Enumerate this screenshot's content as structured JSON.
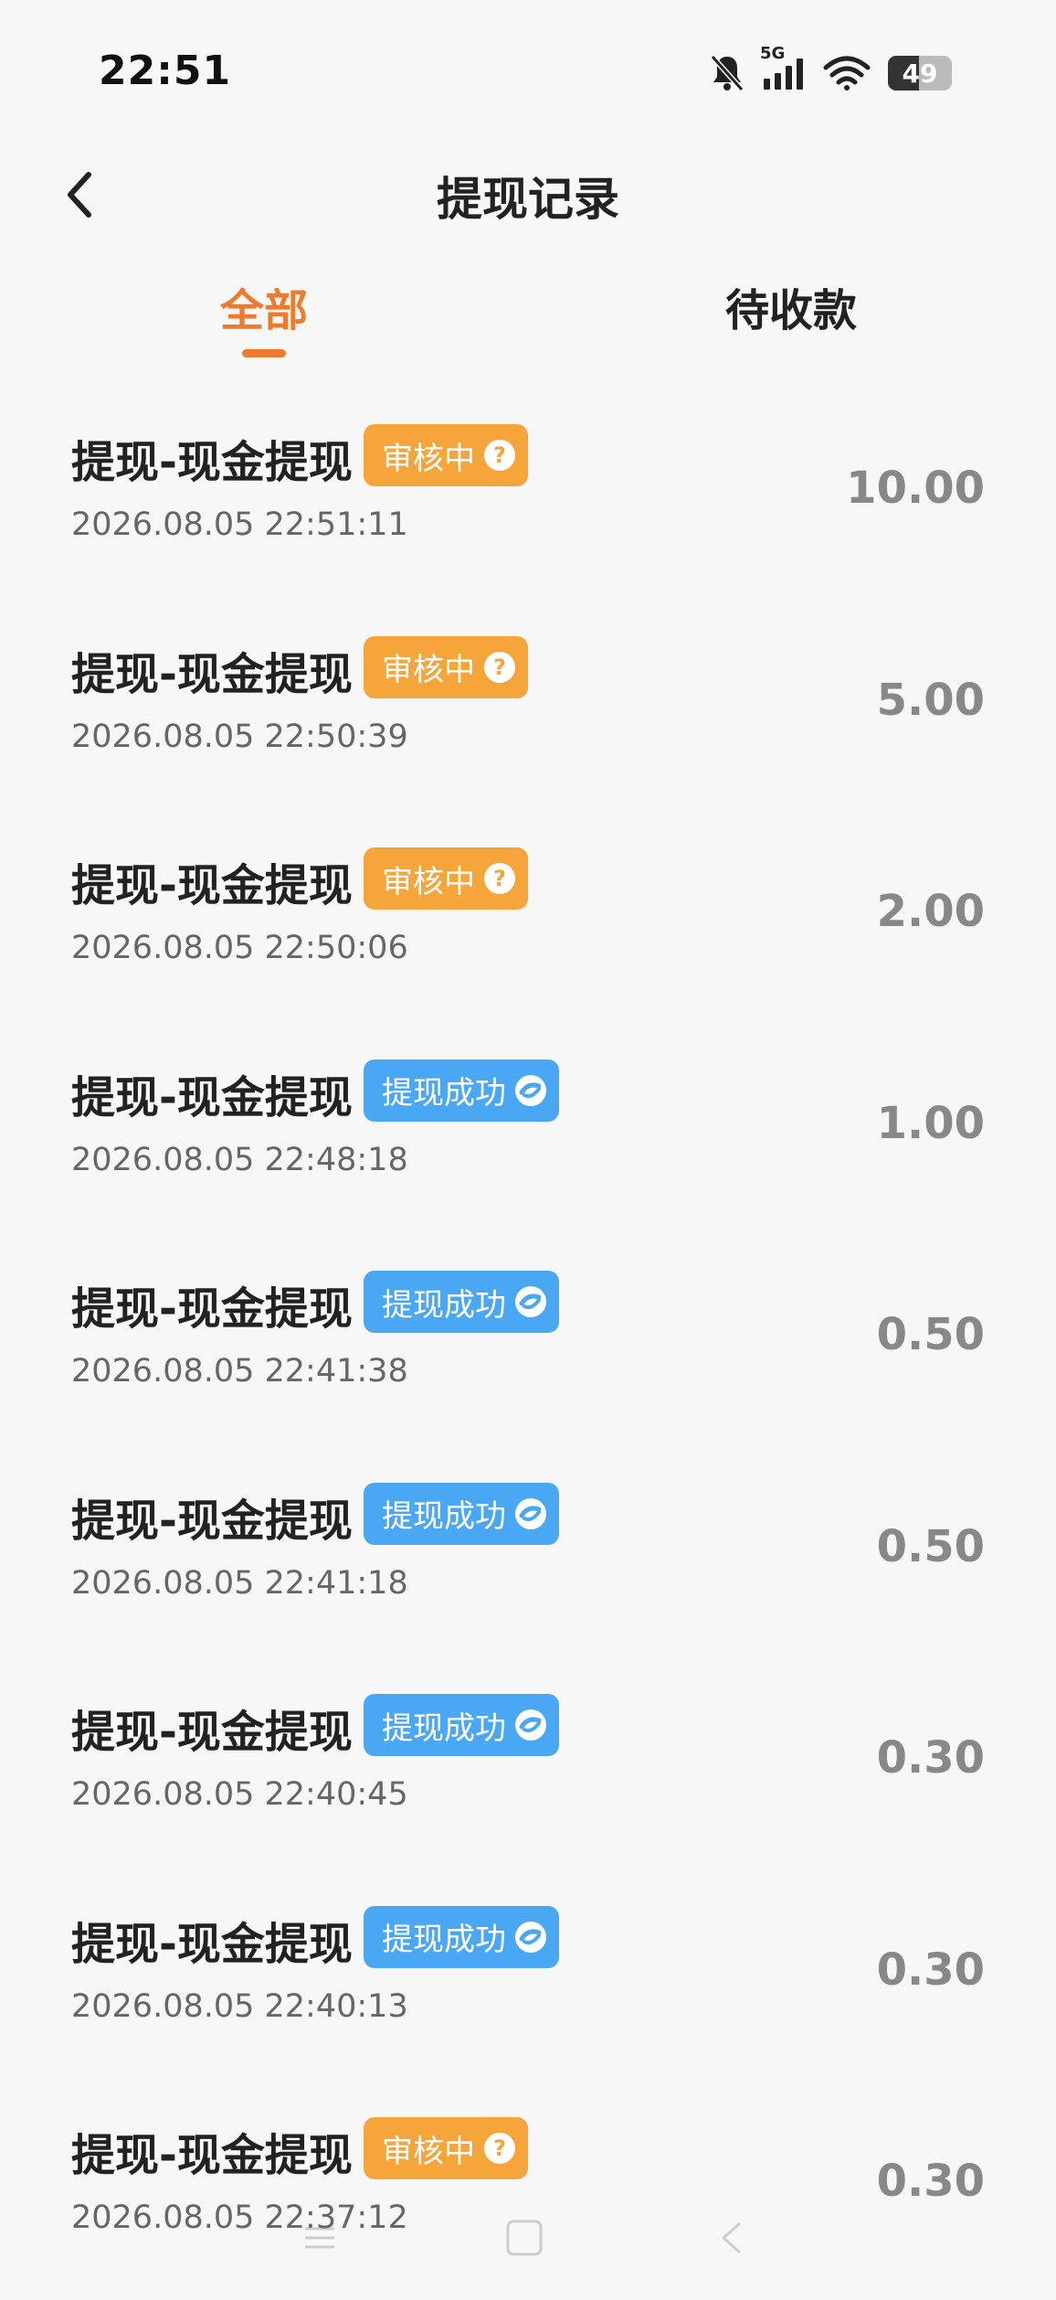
{
  "status_bar": {
    "time": "22:51",
    "network": "5G",
    "battery": "49",
    "battery_level": 0.49,
    "icons": [
      "bell-muted-icon",
      "signal-icon",
      "wifi-icon",
      "battery-icon"
    ]
  },
  "header": {
    "title": "提现记录",
    "back_icon": "chevron-left-icon"
  },
  "tabs": [
    {
      "label": "全部",
      "active": true
    },
    {
      "label": "待收款",
      "active": false
    }
  ],
  "colors": {
    "accent": "#ee7b2d",
    "pending_badge": "#f6a53a",
    "success_badge": "#4aa7f3",
    "amount": "#888888"
  },
  "records": [
    {
      "title": "提现-现金提现",
      "status": "审核中",
      "status_type": "pending",
      "time": "2026.08.05 22:51:11",
      "amount": "10.00"
    },
    {
      "title": "提现-现金提现",
      "status": "审核中",
      "status_type": "pending",
      "time": "2026.08.05 22:50:39",
      "amount": "5.00"
    },
    {
      "title": "提现-现金提现",
      "status": "审核中",
      "status_type": "pending",
      "time": "2026.08.05 22:50:06",
      "amount": "2.00"
    },
    {
      "title": "提现-现金提现",
      "status": "提现成功",
      "status_type": "success",
      "time": "2026.08.05 22:48:18",
      "amount": "1.00"
    },
    {
      "title": "提现-现金提现",
      "status": "提现成功",
      "status_type": "success",
      "time": "2026.08.05 22:41:38",
      "amount": "0.50"
    },
    {
      "title": "提现-现金提现",
      "status": "提现成功",
      "status_type": "success",
      "time": "2026.08.05 22:41:18",
      "amount": "0.50"
    },
    {
      "title": "提现-现金提现",
      "status": "提现成功",
      "status_type": "success",
      "time": "2026.08.05 22:40:45",
      "amount": "0.30"
    },
    {
      "title": "提现-现金提现",
      "status": "提现成功",
      "status_type": "success",
      "time": "2026.08.05 22:40:13",
      "amount": "0.30"
    },
    {
      "title": "提现-现金提现",
      "status": "审核中",
      "status_type": "pending",
      "time": "2026.08.05 22:37:12",
      "amount": "0.30"
    }
  ]
}
